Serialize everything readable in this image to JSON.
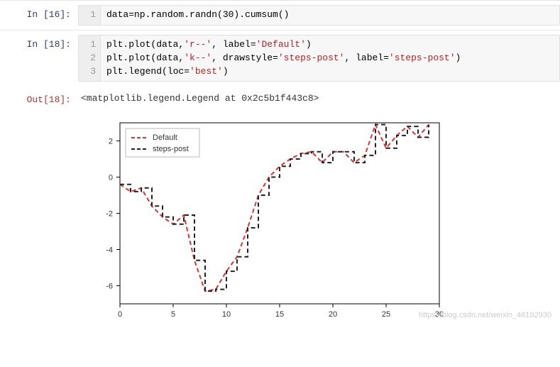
{
  "cells": {
    "c0": {
      "prompt": "In  [16]:",
      "gutter": [
        "1"
      ]
    },
    "c1": {
      "prompt": "In  [18]:",
      "gutter": [
        "1",
        "2",
        "3"
      ]
    },
    "c2": {
      "prompt": "Out[18]:",
      "text": "<matplotlib.legend.Legend at 0x2c5b1f443c8>"
    }
  },
  "code0": "data=np.random.randn(30).cumsum()",
  "code1": {
    "l1a": "plt.plot(data,",
    "l1b": "'r--'",
    "l1c": ", label=",
    "l1d": "'Default'",
    "l1e": ")",
    "l2a": "plt.plot(data,",
    "l2b": "'k--'",
    "l2c": ", drawstyle=",
    "l2d": "'steps-post'",
    "l2e": ", label=",
    "l2f": "'steps-post'",
    "l2g": ")",
    "l3a": "plt.legend(loc=",
    "l3b": "'best'",
    "l3c": ")"
  },
  "chart_data": {
    "type": "line",
    "x": [
      0,
      1,
      2,
      3,
      4,
      5,
      6,
      7,
      8,
      9,
      10,
      11,
      12,
      13,
      14,
      15,
      16,
      17,
      18,
      19,
      20,
      21,
      22,
      23,
      24,
      25,
      26,
      27,
      28,
      29
    ],
    "series": [
      {
        "name": "Default",
        "style": "r--",
        "values": [
          -0.4,
          -0.8,
          -0.6,
          -1.6,
          -2.2,
          -2.6,
          -2.1,
          -4.6,
          -6.3,
          -6.2,
          -5.2,
          -4.4,
          -2.8,
          -1.0,
          0.0,
          0.6,
          1.0,
          1.3,
          1.4,
          0.8,
          1.4,
          1.4,
          0.8,
          1.2,
          2.9,
          1.6,
          2.3,
          2.8,
          2.2,
          2.9
        ]
      },
      {
        "name": "steps-post",
        "style": "k--",
        "drawstyle": "steps-post",
        "values": [
          -0.4,
          -0.8,
          -0.6,
          -1.6,
          -2.2,
          -2.6,
          -2.1,
          -4.6,
          -6.3,
          -6.2,
          -5.2,
          -4.4,
          -2.8,
          -1.0,
          0.0,
          0.6,
          1.0,
          1.3,
          1.4,
          0.8,
          1.4,
          1.4,
          0.8,
          1.2,
          2.9,
          1.6,
          2.3,
          2.8,
          2.2,
          2.9
        ]
      }
    ],
    "xlim": [
      0,
      30
    ],
    "ylim": [
      -7,
      3
    ],
    "xticks": [
      0,
      5,
      10,
      15,
      20,
      25,
      30
    ],
    "yticks": [
      -6,
      -4,
      -2,
      0,
      2
    ],
    "legend_loc": "upper left",
    "legend_labels": [
      "Default",
      "steps-post"
    ]
  },
  "watermark": "https://blog.csdn.net/weixin_46192930"
}
